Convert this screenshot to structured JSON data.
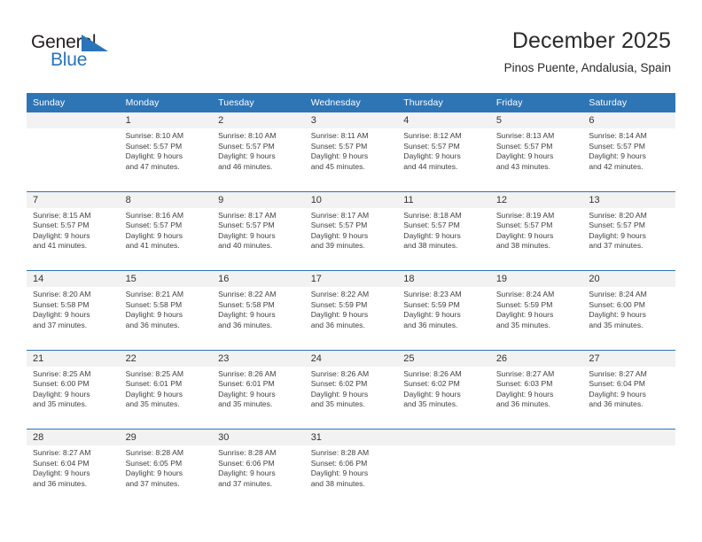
{
  "brand": {
    "name_part1": "General",
    "name_part2": "Blue",
    "triangle_color": "#2a74ba",
    "text_color": "#231f20"
  },
  "header": {
    "title": "December 2025",
    "subtitle": "Pinos Puente, Andalusia, Spain"
  },
  "theme": {
    "header_blue": "#2E75B6",
    "date_row_gray": "#F2F2F2",
    "body_text": "#404040"
  },
  "calendar": {
    "weekday_headers": [
      "Sunday",
      "Monday",
      "Tuesday",
      "Wednesday",
      "Thursday",
      "Friday",
      "Saturday"
    ],
    "weeks": [
      {
        "days": [
          {
            "num": "",
            "sunrise": "",
            "sunset": "",
            "daylight_line1": "",
            "daylight_line2": ""
          },
          {
            "num": "1",
            "sunrise": "Sunrise: 8:10 AM",
            "sunset": "Sunset: 5:57 PM",
            "daylight_line1": "Daylight: 9 hours",
            "daylight_line2": "and 47 minutes."
          },
          {
            "num": "2",
            "sunrise": "Sunrise: 8:10 AM",
            "sunset": "Sunset: 5:57 PM",
            "daylight_line1": "Daylight: 9 hours",
            "daylight_line2": "and 46 minutes."
          },
          {
            "num": "3",
            "sunrise": "Sunrise: 8:11 AM",
            "sunset": "Sunset: 5:57 PM",
            "daylight_line1": "Daylight: 9 hours",
            "daylight_line2": "and 45 minutes."
          },
          {
            "num": "4",
            "sunrise": "Sunrise: 8:12 AM",
            "sunset": "Sunset: 5:57 PM",
            "daylight_line1": "Daylight: 9 hours",
            "daylight_line2": "and 44 minutes."
          },
          {
            "num": "5",
            "sunrise": "Sunrise: 8:13 AM",
            "sunset": "Sunset: 5:57 PM",
            "daylight_line1": "Daylight: 9 hours",
            "daylight_line2": "and 43 minutes."
          },
          {
            "num": "6",
            "sunrise": "Sunrise: 8:14 AM",
            "sunset": "Sunset: 5:57 PM",
            "daylight_line1": "Daylight: 9 hours",
            "daylight_line2": "and 42 minutes."
          }
        ]
      },
      {
        "days": [
          {
            "num": "7",
            "sunrise": "Sunrise: 8:15 AM",
            "sunset": "Sunset: 5:57 PM",
            "daylight_line1": "Daylight: 9 hours",
            "daylight_line2": "and 41 minutes."
          },
          {
            "num": "8",
            "sunrise": "Sunrise: 8:16 AM",
            "sunset": "Sunset: 5:57 PM",
            "daylight_line1": "Daylight: 9 hours",
            "daylight_line2": "and 41 minutes."
          },
          {
            "num": "9",
            "sunrise": "Sunrise: 8:17 AM",
            "sunset": "Sunset: 5:57 PM",
            "daylight_line1": "Daylight: 9 hours",
            "daylight_line2": "and 40 minutes."
          },
          {
            "num": "10",
            "sunrise": "Sunrise: 8:17 AM",
            "sunset": "Sunset: 5:57 PM",
            "daylight_line1": "Daylight: 9 hours",
            "daylight_line2": "and 39 minutes."
          },
          {
            "num": "11",
            "sunrise": "Sunrise: 8:18 AM",
            "sunset": "Sunset: 5:57 PM",
            "daylight_line1": "Daylight: 9 hours",
            "daylight_line2": "and 38 minutes."
          },
          {
            "num": "12",
            "sunrise": "Sunrise: 8:19 AM",
            "sunset": "Sunset: 5:57 PM",
            "daylight_line1": "Daylight: 9 hours",
            "daylight_line2": "and 38 minutes."
          },
          {
            "num": "13",
            "sunrise": "Sunrise: 8:20 AM",
            "sunset": "Sunset: 5:57 PM",
            "daylight_line1": "Daylight: 9 hours",
            "daylight_line2": "and 37 minutes."
          }
        ]
      },
      {
        "days": [
          {
            "num": "14",
            "sunrise": "Sunrise: 8:20 AM",
            "sunset": "Sunset: 5:58 PM",
            "daylight_line1": "Daylight: 9 hours",
            "daylight_line2": "and 37 minutes."
          },
          {
            "num": "15",
            "sunrise": "Sunrise: 8:21 AM",
            "sunset": "Sunset: 5:58 PM",
            "daylight_line1": "Daylight: 9 hours",
            "daylight_line2": "and 36 minutes."
          },
          {
            "num": "16",
            "sunrise": "Sunrise: 8:22 AM",
            "sunset": "Sunset: 5:58 PM",
            "daylight_line1": "Daylight: 9 hours",
            "daylight_line2": "and 36 minutes."
          },
          {
            "num": "17",
            "sunrise": "Sunrise: 8:22 AM",
            "sunset": "Sunset: 5:59 PM",
            "daylight_line1": "Daylight: 9 hours",
            "daylight_line2": "and 36 minutes."
          },
          {
            "num": "18",
            "sunrise": "Sunrise: 8:23 AM",
            "sunset": "Sunset: 5:59 PM",
            "daylight_line1": "Daylight: 9 hours",
            "daylight_line2": "and 36 minutes."
          },
          {
            "num": "19",
            "sunrise": "Sunrise: 8:24 AM",
            "sunset": "Sunset: 5:59 PM",
            "daylight_line1": "Daylight: 9 hours",
            "daylight_line2": "and 35 minutes."
          },
          {
            "num": "20",
            "sunrise": "Sunrise: 8:24 AM",
            "sunset": "Sunset: 6:00 PM",
            "daylight_line1": "Daylight: 9 hours",
            "daylight_line2": "and 35 minutes."
          }
        ]
      },
      {
        "days": [
          {
            "num": "21",
            "sunrise": "Sunrise: 8:25 AM",
            "sunset": "Sunset: 6:00 PM",
            "daylight_line1": "Daylight: 9 hours",
            "daylight_line2": "and 35 minutes."
          },
          {
            "num": "22",
            "sunrise": "Sunrise: 8:25 AM",
            "sunset": "Sunset: 6:01 PM",
            "daylight_line1": "Daylight: 9 hours",
            "daylight_line2": "and 35 minutes."
          },
          {
            "num": "23",
            "sunrise": "Sunrise: 8:26 AM",
            "sunset": "Sunset: 6:01 PM",
            "daylight_line1": "Daylight: 9 hours",
            "daylight_line2": "and 35 minutes."
          },
          {
            "num": "24",
            "sunrise": "Sunrise: 8:26 AM",
            "sunset": "Sunset: 6:02 PM",
            "daylight_line1": "Daylight: 9 hours",
            "daylight_line2": "and 35 minutes."
          },
          {
            "num": "25",
            "sunrise": "Sunrise: 8:26 AM",
            "sunset": "Sunset: 6:02 PM",
            "daylight_line1": "Daylight: 9 hours",
            "daylight_line2": "and 35 minutes."
          },
          {
            "num": "26",
            "sunrise": "Sunrise: 8:27 AM",
            "sunset": "Sunset: 6:03 PM",
            "daylight_line1": "Daylight: 9 hours",
            "daylight_line2": "and 36 minutes."
          },
          {
            "num": "27",
            "sunrise": "Sunrise: 8:27 AM",
            "sunset": "Sunset: 6:04 PM",
            "daylight_line1": "Daylight: 9 hours",
            "daylight_line2": "and 36 minutes."
          }
        ]
      },
      {
        "days": [
          {
            "num": "28",
            "sunrise": "Sunrise: 8:27 AM",
            "sunset": "Sunset: 6:04 PM",
            "daylight_line1": "Daylight: 9 hours",
            "daylight_line2": "and 36 minutes."
          },
          {
            "num": "29",
            "sunrise": "Sunrise: 8:28 AM",
            "sunset": "Sunset: 6:05 PM",
            "daylight_line1": "Daylight: 9 hours",
            "daylight_line2": "and 37 minutes."
          },
          {
            "num": "30",
            "sunrise": "Sunrise: 8:28 AM",
            "sunset": "Sunset: 6:06 PM",
            "daylight_line1": "Daylight: 9 hours",
            "daylight_line2": "and 37 minutes."
          },
          {
            "num": "31",
            "sunrise": "Sunrise: 8:28 AM",
            "sunset": "Sunset: 6:06 PM",
            "daylight_line1": "Daylight: 9 hours",
            "daylight_line2": "and 38 minutes."
          },
          {
            "num": "",
            "sunrise": "",
            "sunset": "",
            "daylight_line1": "",
            "daylight_line2": ""
          },
          {
            "num": "",
            "sunrise": "",
            "sunset": "",
            "daylight_line1": "",
            "daylight_line2": ""
          },
          {
            "num": "",
            "sunrise": "",
            "sunset": "",
            "daylight_line1": "",
            "daylight_line2": ""
          }
        ]
      }
    ]
  }
}
